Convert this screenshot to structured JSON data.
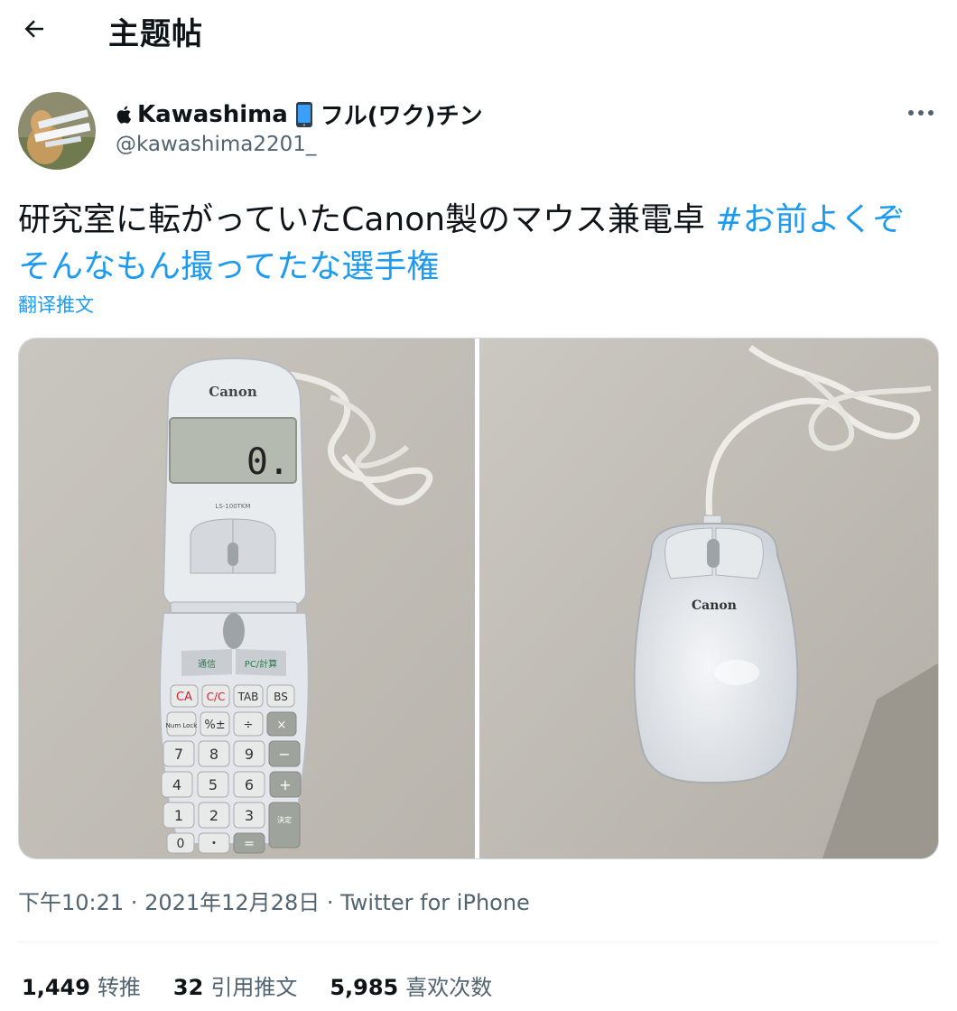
{
  "header": {
    "title": "主题帖"
  },
  "author": {
    "display_name": "Kawashima",
    "display_name_suffix": "フル(ワク)チン",
    "handle": "@kawashima2201_"
  },
  "tweet": {
    "text_plain": "研究室に転がっていたCanon製のマウス兼電卓 ",
    "hashtag": "#お前よくぞそんなもん撮ってたな選手権",
    "translate_label": "翻译推文"
  },
  "media": {
    "left_photo": {
      "brand": "Canon",
      "model": "LS-100TKM",
      "display_value": "0.",
      "button_labels": [
        "通信",
        "PC/計算"
      ],
      "keys": [
        [
          "CA",
          "C/C",
          "TAB",
          "BS"
        ],
        [
          "Num Lock",
          "%±",
          "÷",
          "×"
        ],
        [
          "7",
          "8",
          "9",
          "−"
        ],
        [
          "4",
          "5",
          "6",
          "+"
        ],
        [
          "1",
          "2",
          "3",
          "決定"
        ],
        [
          "0",
          "・",
          "=",
          ""
        ]
      ]
    },
    "right_photo": {
      "brand": "Canon"
    }
  },
  "meta": {
    "time": "下午10:21",
    "date": "2021年12月28日",
    "source": "Twitter for iPhone",
    "separator": " · "
  },
  "stats": {
    "retweets_value": "1,449",
    "retweets_label": "转推",
    "quotes_value": "32",
    "quotes_label": "引用推文",
    "likes_value": "5,985",
    "likes_label": "喜欢次数"
  },
  "colors": {
    "link": "#1d9bf0",
    "secondary": "#536471",
    "text": "#0f1419"
  }
}
